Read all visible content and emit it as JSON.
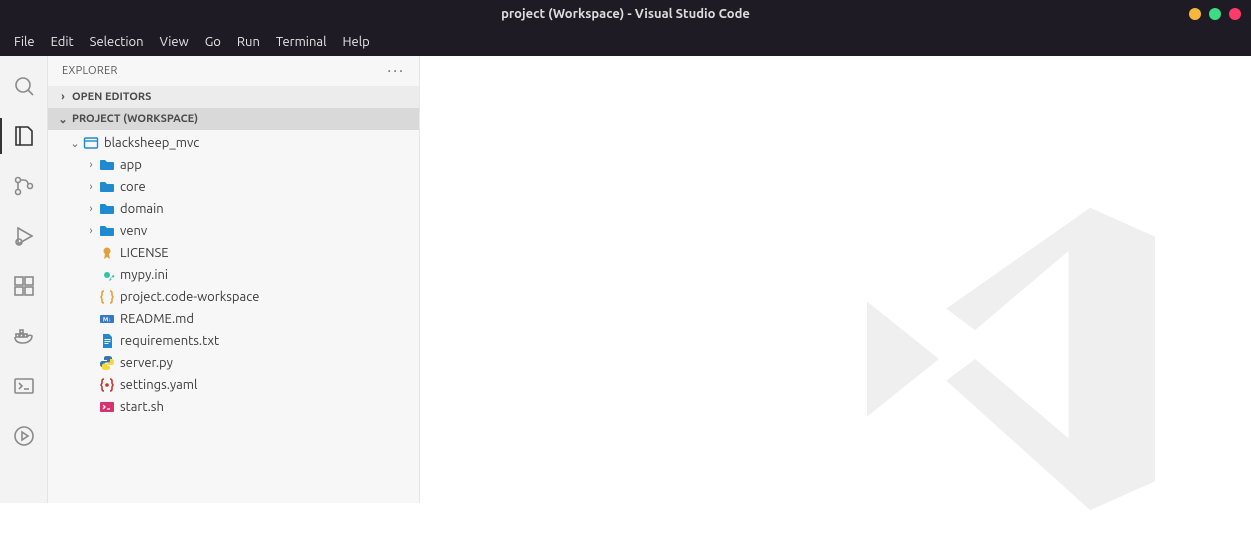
{
  "title": "project (Workspace) - Visual Studio Code",
  "menubar": [
    "File",
    "Edit",
    "Selection",
    "View",
    "Go",
    "Run",
    "Terminal",
    "Help"
  ],
  "sidebar": {
    "title": "EXPLORER",
    "sections": {
      "open_editors": "OPEN EDITORS",
      "workspace": "PROJECT (WORKSPACE)"
    },
    "root": {
      "name": "blacksheep_mvc",
      "folders": [
        "app",
        "core",
        "domain",
        "venv"
      ],
      "files": [
        {
          "name": "LICENSE",
          "icon": "cert"
        },
        {
          "name": "mypy.ini",
          "icon": "gear"
        },
        {
          "name": "project.code-workspace",
          "icon": "braces"
        },
        {
          "name": "README.md",
          "icon": "md"
        },
        {
          "name": "requirements.txt",
          "icon": "txt"
        },
        {
          "name": "server.py",
          "icon": "python"
        },
        {
          "name": "settings.yaml",
          "icon": "braces-red"
        },
        {
          "name": "start.sh",
          "icon": "terminal"
        }
      ]
    }
  }
}
